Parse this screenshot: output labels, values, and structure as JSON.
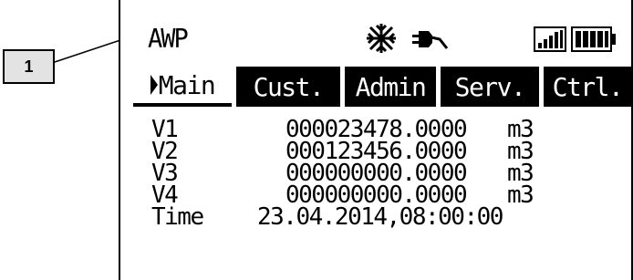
{
  "callout": {
    "number": "1"
  },
  "status": {
    "mode": "AWP",
    "icons": [
      "snowflake-icon",
      "plug-icon",
      "signal-strength-icon",
      "battery-icon"
    ]
  },
  "tabs": [
    {
      "label": "Main",
      "active": true
    },
    {
      "label": "Cust.",
      "active": false
    },
    {
      "label": "Admin",
      "active": false
    },
    {
      "label": "Serv.",
      "active": false
    },
    {
      "label": "Ctrl.",
      "active": false
    }
  ],
  "readings": [
    {
      "label": "V1",
      "value": "000023478.0000",
      "unit": "m3"
    },
    {
      "label": "V2",
      "value": "000123456.0000",
      "unit": "m3"
    },
    {
      "label": "V3",
      "value": "000000000.0000",
      "unit": "m3"
    },
    {
      "label": "V4",
      "value": "000000000.0000",
      "unit": "m3"
    }
  ],
  "time": {
    "label": "Time",
    "value": "23.04.2014,08:00:00"
  },
  "colors": {
    "foreground": "#000000",
    "background": "#ffffff",
    "callout_fill": "#e3e3e3"
  }
}
